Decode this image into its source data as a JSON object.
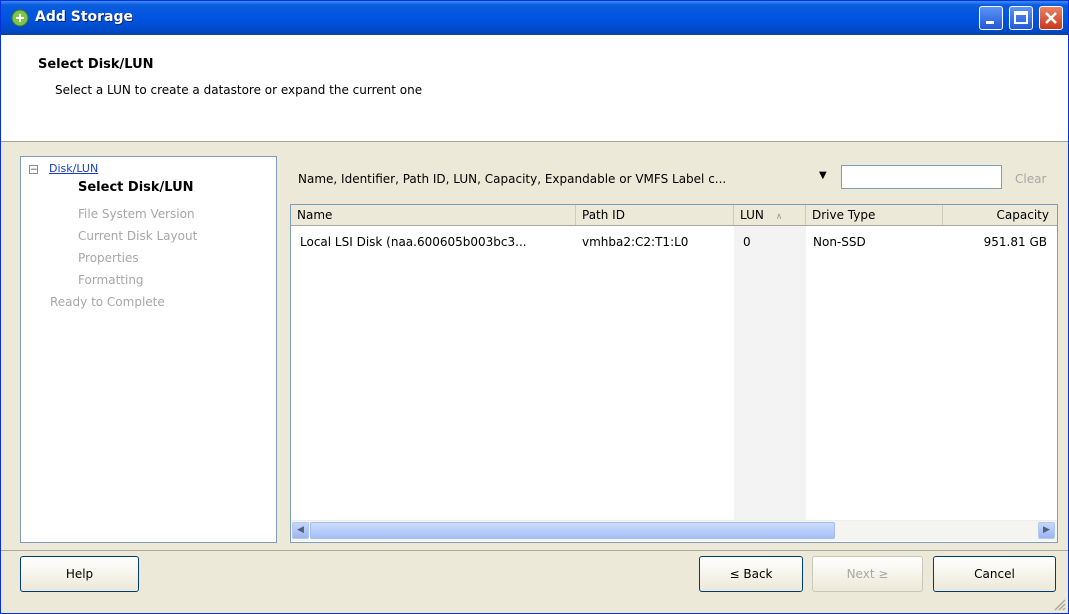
{
  "window": {
    "title": "Add Storage"
  },
  "header": {
    "title": "Select Disk/LUN",
    "subtitle": "Select a LUN to create a datastore or expand the current one"
  },
  "nav": {
    "root": "Disk/LUN",
    "items": [
      {
        "label": "Select Disk/LUN",
        "active": true
      },
      {
        "label": "File System Version",
        "active": false
      },
      {
        "label": "Current Disk Layout",
        "active": false
      },
      {
        "label": "Properties",
        "active": false
      },
      {
        "label": "Formatting",
        "active": false
      }
    ],
    "final": "Ready to Complete"
  },
  "filter": {
    "label": "Name, Identifier, Path ID, LUN, Capacity, Expandable or VMFS Label c...",
    "value": "",
    "clear": "Clear"
  },
  "table": {
    "headers": [
      "Name",
      "Path ID",
      "LUN",
      "Drive Type",
      "Capacity"
    ],
    "sort_indicator": "∧",
    "rows": [
      [
        "Local LSI Disk (naa.600605b003bc3...",
        "vmhba2:C2:T1:L0",
        "0",
        "Non-SSD",
        "951.81 GB"
      ]
    ]
  },
  "buttons": {
    "help": "Help",
    "back": "≤ Back",
    "next": "Next ≥",
    "cancel": "Cancel"
  },
  "colors": {
    "titlebar": "#0054e3",
    "window_bg": "#ece9d8",
    "link": "#1a3dc7",
    "disabled": "#a7a7a7"
  }
}
